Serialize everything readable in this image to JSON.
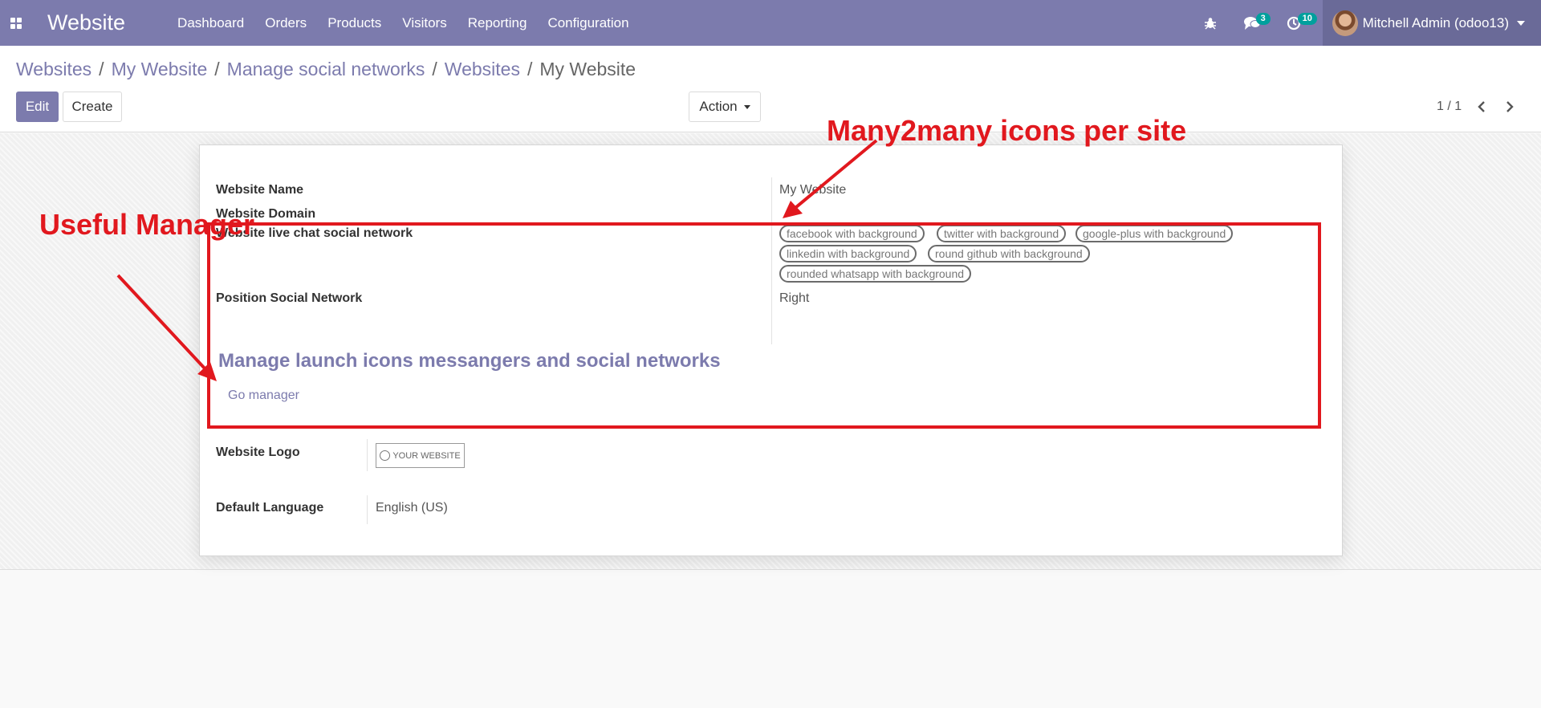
{
  "navbar": {
    "app_name": "Website",
    "menu": [
      "Dashboard",
      "Orders",
      "Products",
      "Visitors",
      "Reporting",
      "Configuration"
    ],
    "messages_count": "3",
    "activities_count": "10",
    "user_name": "Mitchell Admin (odoo13)"
  },
  "breadcrumb": [
    "Websites",
    "My Website",
    "Manage social networks",
    "Websites"
  ],
  "breadcrumb_active": "My Website",
  "controls": {
    "edit_label": "Edit",
    "create_label": "Create",
    "action_label": "Action",
    "pager": "1 / 1"
  },
  "form": {
    "website_name_label": "Website Name",
    "website_name": "My Website",
    "website_domain_label": "Website Domain",
    "live_chat_label": "Website live chat social network",
    "social_tags": [
      "facebook with background",
      "twitter with background",
      "google-plus with background",
      "linkedin with background",
      "round github with background",
      "rounded whatsapp with background"
    ],
    "position_label": "Position Social Network",
    "position_value": "Right",
    "section_title": "Manage launch icons messangers and social networks",
    "go_manager_label": "Go manager",
    "logo_label": "Website Logo",
    "logo_text": "YOUR WEBSITE",
    "language_label": "Default Language",
    "language_value": "English (US)"
  },
  "annotations": {
    "manager_note": "Useful Manager",
    "icons_note": "Many2many icons per site",
    "color": "#e1181e"
  },
  "colors": {
    "primary": "#7c7bad",
    "badge": "#00a09d"
  }
}
